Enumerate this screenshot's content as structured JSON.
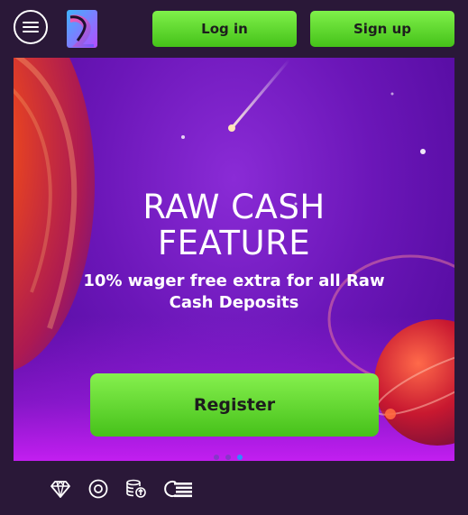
{
  "header": {
    "login_label": "Log in",
    "signup_label": "Sign up",
    "menu_icon": "hamburger-menu-icon",
    "logo_icon": "site-logo"
  },
  "banner": {
    "title_line1": "RAW CASH",
    "title_line2": "FEATURE",
    "subtitle": "10% wager free extra for all Raw Cash Deposits",
    "register_label": "Register",
    "slides_total": 3,
    "active_slide": 3
  },
  "bottom_nav": {
    "items": [
      {
        "icon": "diamond-icon"
      },
      {
        "icon": "target-icon"
      },
      {
        "icon": "coins-upload-icon"
      },
      {
        "icon": "live-list-icon"
      }
    ]
  },
  "colors": {
    "background": "#2a1838",
    "accent_green": "#5fd62f",
    "banner_purple": "#6b16b8",
    "active_dot": "#2d8cff"
  }
}
